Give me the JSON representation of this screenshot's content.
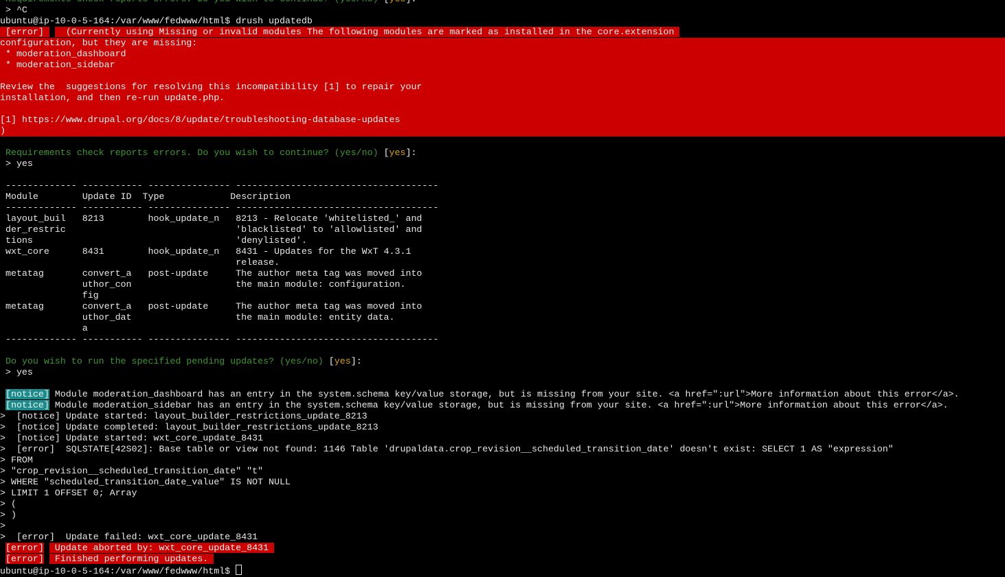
{
  "terminal": {
    "prev_prompt": {
      "question": " Requirements check reports errors. Do you wish to continue? (yes/no) ",
      "default_open": "[",
      "default_value": "yes",
      "default_close": "]:"
    },
    "ctrl_c": " > ^C",
    "command_line": "ubuntu@ip-10-0-5-164:/var/www/fedwww/html$ drush updatedb",
    "error_block": {
      "badge": "[error]",
      "first_line": "  (Currently using Missing or invalid modules The following modules are marked as installed in the core.extension ",
      "lines": [
        "configuration, but they are missing:",
        " * moderation_dashboard",
        " * moderation_sidebar",
        "",
        "Review the  suggestions for resolving this incompatibility [1] to repair your",
        "installation, and then re-run update.php.",
        "",
        "[1] https://www.drupal.org/docs/8/update/troubleshooting-database-updates",
        ")"
      ]
    },
    "prompt1": {
      "question": " Requirements check reports errors. Do you wish to continue? (yes/no) ",
      "default_open": "[",
      "default_value": "yes",
      "default_close": "]:",
      "answer": " > yes"
    },
    "table": {
      "rule": " ------------- ----------- --------------- -------------------------------------",
      "headers": [
        " Module        ",
        "Update ID  ",
        "Type           ",
        " Description"
      ],
      "rows": [
        " layout_buil   8213        hook_update_n   8213 - Relocate 'whitelisted_' and",
        " der_restric                               'blacklisted' to 'allowlisted' and",
        " tions                                     'denylisted'.",
        " wxt_core      8431        hook_update_n   8431 - Updates for the WxT 4.3.1",
        "                                           release.",
        " metatag       convert_a   post-update     The author meta tag was moved into",
        "               uthor_con                   the main module: configuration.",
        "               fig",
        " metatag       convert_a   post-update     The author meta tag was moved into",
        "               uthor_dat                   the main module: entity data.",
        "               a"
      ],
      "entries": [
        {
          "module": "layout_builder_restrictions",
          "update_id": "8213",
          "type": "hook_update_n",
          "description": "8213 - Relocate 'whitelisted_' and 'blacklisted' to 'allowlisted' and 'denylisted'."
        },
        {
          "module": "wxt_core",
          "update_id": "8431",
          "type": "hook_update_n",
          "description": "8431 - Updates for the WxT 4.3.1 release."
        },
        {
          "module": "metatag",
          "update_id": "convert_author_config",
          "type": "post-update",
          "description": "The author meta tag was moved into the main module: configuration."
        },
        {
          "module": "metatag",
          "update_id": "convert_author_data",
          "type": "post-update",
          "description": "The author meta tag was moved into the main module: entity data."
        }
      ]
    },
    "prompt2": {
      "question": " Do you wish to run the specified pending updates? (yes/no) ",
      "default_open": "[",
      "default_value": "yes",
      "default_close": "]:",
      "answer": " > yes"
    },
    "notices": [
      {
        "badge": "[notice]",
        "text": " Module moderation_dashboard has an entry in the system.schema key/value storage, but is missing from your site. <a href=\":url\">More information about this error</a>."
      },
      {
        "badge": "[notice]",
        "text": " Module moderation_sidebar has an entry in the system.schema key/value storage, but is missing from your site. <a href=\":url\">More information about this error</a>."
      }
    ],
    "log_lines": [
      ">  [notice] Update started: layout_builder_restrictions_update_8213",
      ">  [notice] Update completed: layout_builder_restrictions_update_8213",
      ">  [notice] Update started: wxt_core_update_8431",
      ">  [error]  SQLSTATE[42S02]: Base table or view not found: 1146 Table 'drupaldata.crop_revision__scheduled_transition_date' doesn't exist: SELECT 1 AS \"expression\"",
      "> FROM",
      "> \"crop_revision__scheduled_transition_date\" \"t\"",
      "> WHERE \"scheduled_transition_date_value\" IS NOT NULL",
      "> LIMIT 1 OFFSET 0; Array",
      "> (",
      "> )",
      ">",
      ">  [error]  Update failed: wxt_core_update_8431"
    ],
    "final_errors": [
      {
        "badge": "[error]",
        "text": " Update aborted by: wxt_core_update_8431 "
      },
      {
        "badge": "[error]",
        "text": " Finished performing updates. "
      }
    ],
    "final_prompt": "ubuntu@ip-10-0-5-164:/var/www/fedwww/html$ ",
    "colors": {
      "background": "#000000",
      "error_red": "#cc0000",
      "notice_teal": "#1b8b8b",
      "prompt_green": "#3a9a2a",
      "default_yellow": "#d8a400"
    }
  }
}
